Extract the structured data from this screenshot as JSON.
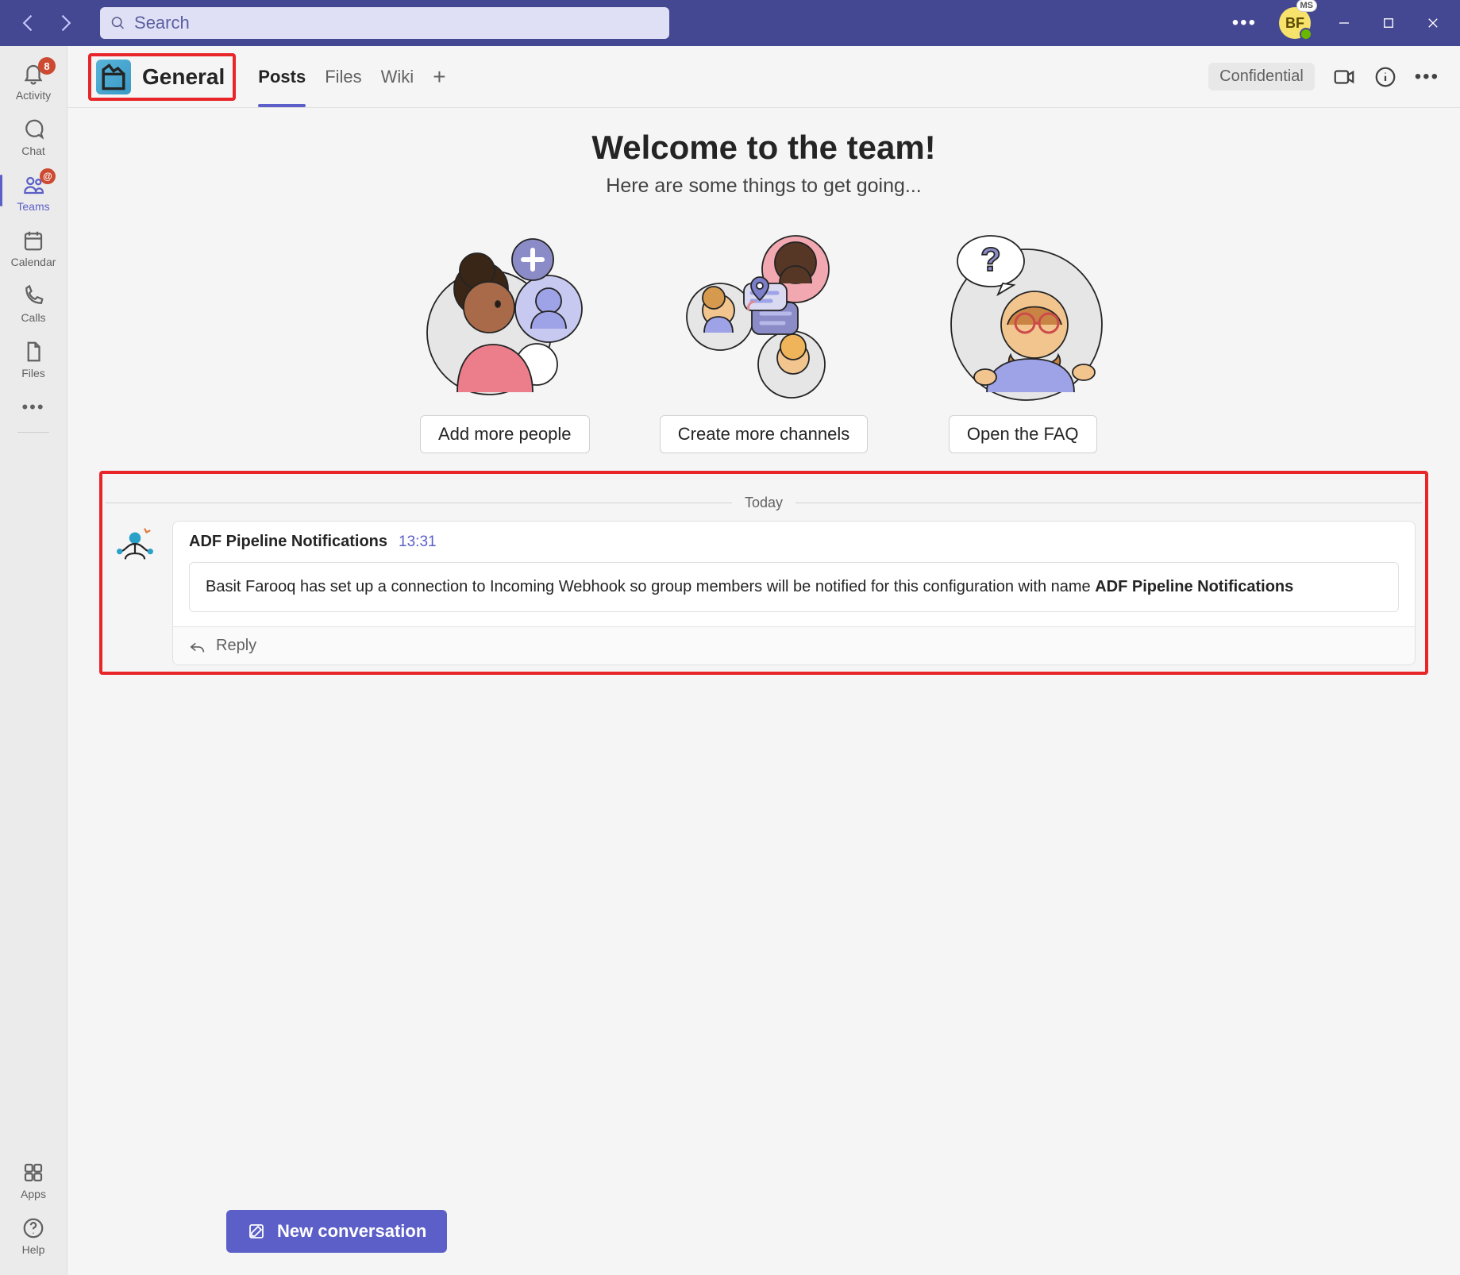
{
  "titlebar": {
    "search_placeholder": "Search",
    "avatar_initials": "BF",
    "avatar_badge": "MS"
  },
  "rail": {
    "items": [
      {
        "label": "Activity",
        "badge": "8"
      },
      {
        "label": "Chat"
      },
      {
        "label": "Teams",
        "mention": "@"
      },
      {
        "label": "Calendar"
      },
      {
        "label": "Calls"
      },
      {
        "label": "Files"
      }
    ],
    "apps_label": "Apps",
    "help_label": "Help"
  },
  "channel": {
    "name": "General",
    "tabs": [
      "Posts",
      "Files",
      "Wiki"
    ],
    "confidential_label": "Confidential"
  },
  "welcome": {
    "title": "Welcome to the team!",
    "subtitle": "Here are some things to get going...",
    "tiles": [
      {
        "button": "Add more people"
      },
      {
        "button": "Create more channels"
      },
      {
        "button": "Open the FAQ"
      }
    ]
  },
  "feed": {
    "day_label": "Today",
    "message": {
      "author": "ADF Pipeline Notifications",
      "time": "13:31",
      "body_prefix": "Basit Farooq has set up a connection to Incoming Webhook so group members will be notified for this configuration with name ",
      "body_bold": "ADF Pipeline Notifications",
      "reply_label": "Reply"
    }
  },
  "compose": {
    "new_conversation": "New conversation"
  }
}
